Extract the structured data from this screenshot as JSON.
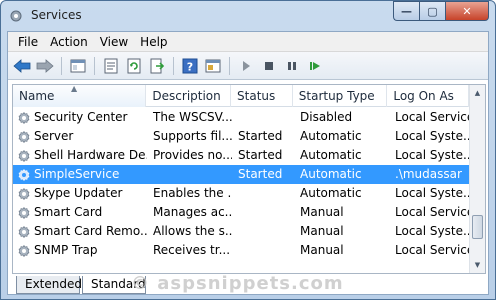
{
  "window": {
    "title": "Services",
    "minimize": "—",
    "maximize": "▢",
    "close": "✕"
  },
  "menu": [
    "File",
    "Action",
    "View",
    "Help"
  ],
  "toolbar": {
    "buttons": [
      "back-icon",
      "forward-icon",
      "console-tree-icon",
      "properties-icon",
      "refresh-icon",
      "export-icon",
      "help-icon",
      "view-icon",
      "start-icon",
      "stop-icon",
      "pause-icon",
      "restart-icon"
    ]
  },
  "table": {
    "columns": [
      "Name",
      "Description",
      "Status",
      "Startup Type",
      "Log On As"
    ],
    "sorted_column": "Name",
    "rows": [
      {
        "name": "Security Center",
        "description": "The WSCSV...",
        "status": "",
        "startup": "Disabled",
        "logon": "Local Service",
        "selected": false
      },
      {
        "name": "Server",
        "description": "Supports fil...",
        "status": "Started",
        "startup": "Automatic",
        "logon": "Local Syste...",
        "selected": false
      },
      {
        "name": "Shell Hardware De...",
        "description": "Provides no...",
        "status": "Started",
        "startup": "Automatic",
        "logon": "Local Syste...",
        "selected": false
      },
      {
        "name": "SimpleService",
        "description": "",
        "status": "Started",
        "startup": "Automatic",
        "logon": ".\\mudassar",
        "selected": true
      },
      {
        "name": "Skype Updater",
        "description": "Enables the ...",
        "status": "",
        "startup": "Automatic",
        "logon": "Local Syste...",
        "selected": false
      },
      {
        "name": "Smart Card",
        "description": "Manages ac...",
        "status": "",
        "startup": "Manual",
        "logon": "Local Service",
        "selected": false
      },
      {
        "name": "Smart Card Remo...",
        "description": "Allows the s...",
        "status": "",
        "startup": "Manual",
        "logon": "Local Syste...",
        "selected": false
      },
      {
        "name": "SNMP Trap",
        "description": "Receives tr...",
        "status": "",
        "startup": "Manual",
        "logon": "Local Service",
        "selected": false
      }
    ]
  },
  "tabs": [
    "Extended",
    "Standard"
  ],
  "watermark": "© aspsnippets.com",
  "colors": {
    "selection": "#3399ff",
    "titlebar": "#c9dbee",
    "close": "#c7432a"
  }
}
